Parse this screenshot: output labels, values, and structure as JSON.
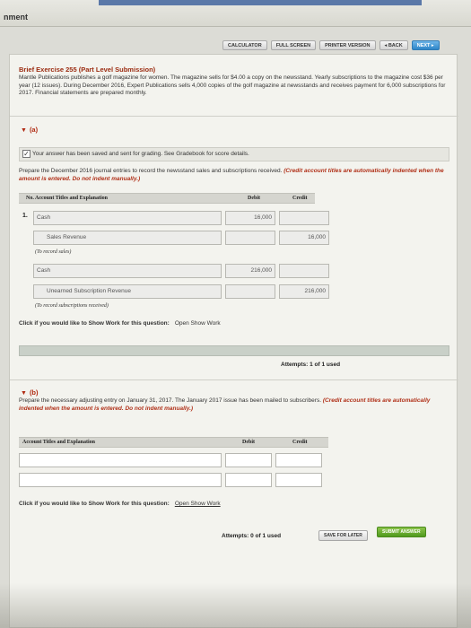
{
  "window": {
    "title": "nment"
  },
  "nav": {
    "calculator": "CALCULATOR",
    "fullscreen": "FULL SCREEN",
    "printer": "PRINTER VERSION",
    "back": "◂ BACK",
    "next": "NEXT ▸"
  },
  "exercise": {
    "title": "Brief Exercise 255 (Part Level Submission)",
    "description": "Mantle Publications publishes a golf magazine for women. The magazine sells for $4.00 a copy on the newsstand. Yearly subscriptions to the magazine cost $36 per year (12 issues). During December 2016, Expert Publications sells 4,000 copies of the golf magazine at newsstands and receives payment for 6,000 subscriptions for 2017. Financial statements are prepared monthly."
  },
  "partA": {
    "label": "(a)",
    "saved_message": "Your answer has been saved and sent for grading. See Gradebook for score details.",
    "prompt": "Prepare the December 2016 journal entries to record the newsstand sales and subscriptions received.",
    "prompt_note": "(Credit account titles are automatically indented when the amount is entered. Do not indent manually.)",
    "headers": {
      "account": "No.  Account Titles and Explanation",
      "debit": "Debit",
      "credit": "Credit"
    },
    "row_number": "1.",
    "entries": [
      {
        "account": "Cash",
        "debit": "16,000",
        "credit": ""
      },
      {
        "account": "Sales Revenue",
        "debit": "",
        "credit": "16,000"
      },
      {
        "note": "(To record sales)"
      },
      {
        "account": "Cash",
        "debit": "216,000",
        "credit": ""
      },
      {
        "account": "Unearned Subscription Revenue",
        "debit": "",
        "credit": "216,000"
      },
      {
        "note": "(To record subscriptions received)"
      }
    ],
    "show_work_label": "Click if you would like to Show Work for this question:",
    "show_work_link": "Open Show Work",
    "attempts": "Attempts: 1 of 1 used"
  },
  "partB": {
    "label": "(b)",
    "prompt": "Prepare the necessary adjusting entry on January 31, 2017. The January 2017 issue has been mailed to subscribers.",
    "prompt_note": "(Credit account titles are automatically indented when the amount is entered. Do not indent manually.)",
    "headers": {
      "account": "Account Titles and Explanation",
      "debit": "Debit",
      "credit": "Credit"
    },
    "show_work_label": "Click if you would like to Show Work for this question:",
    "show_work_link": "Open Show Work",
    "attempts": "Attempts: 0 of 1 used",
    "save_label": "SAVE FOR LATER",
    "submit_label": "SUBMIT ANSWER"
  }
}
